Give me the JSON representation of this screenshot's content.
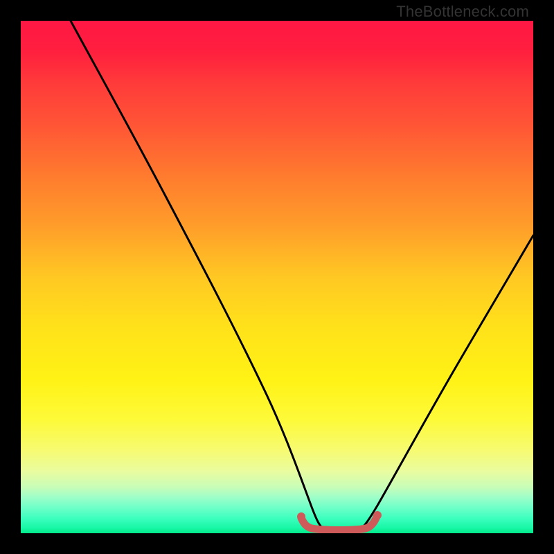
{
  "watermark": "TheBottleneck.com",
  "chart_data": {
    "type": "line",
    "title": "",
    "xlabel": "",
    "ylabel": "",
    "xlim": [
      0,
      100
    ],
    "ylim": [
      0,
      100
    ],
    "series": [
      {
        "name": "bottleneck-curve",
        "x": [
          10,
          15,
          20,
          25,
          30,
          35,
          40,
          45,
          50,
          52,
          55,
          58,
          60,
          61,
          62,
          65,
          68,
          70,
          75,
          80,
          85,
          90,
          95,
          100
        ],
        "y": [
          100,
          91,
          82,
          73,
          64,
          55,
          45,
          35,
          22,
          14,
          6,
          1,
          0,
          0,
          0,
          0,
          1,
          5,
          14,
          24,
          34,
          43,
          51,
          58
        ]
      },
      {
        "name": "optimal-zone",
        "x": [
          55,
          56,
          57,
          58,
          59,
          60,
          61,
          62,
          63,
          64,
          65,
          66,
          67
        ],
        "y": [
          2.3,
          1.2,
          0.7,
          0.5,
          0.4,
          0.3,
          0.3,
          0.3,
          0.3,
          0.4,
          0.6,
          1.2,
          2.4
        ]
      }
    ],
    "legend": [],
    "grid": false,
    "annotations": []
  },
  "colors": {
    "curve": "#000000",
    "optimal_zone": "#cf5a5a",
    "background_top": "#ff1744",
    "background_bottom": "#02e889"
  }
}
